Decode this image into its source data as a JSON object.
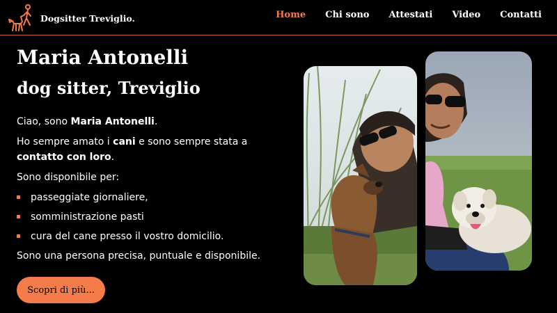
{
  "header": {
    "brand": "Dogsitter Treviglio.",
    "nav": [
      {
        "label": "Home",
        "active": true
      },
      {
        "label": "Chi sono",
        "active": false
      },
      {
        "label": "Attestati",
        "active": false
      },
      {
        "label": "Video",
        "active": false
      },
      {
        "label": "Contatti",
        "active": false
      }
    ]
  },
  "hero": {
    "title": "Maria Antonelli",
    "subtitle": "dog sitter, Treviglio"
  },
  "intro": {
    "greeting": "Ciao, sono ",
    "name": "Maria Antonelli",
    "greeting_end": ".",
    "love_1": "Ho sempre amato i ",
    "love_bold": "cani",
    "love_2": " e sono sempre stata a ",
    "contact_bold": "contatto con loro",
    "contact_end": ".",
    "available": "Sono disponibile per:",
    "services": [
      "passeggiate giornaliere,",
      "somministrazione pasti",
      "cura del cane presso il vostro domicilio."
    ],
    "closing": "Sono una persona precisa, puntuale e disponibile."
  },
  "cta": {
    "label": "Scopri di più..."
  },
  "colors": {
    "accent": "#f47c4b",
    "background": "#000000",
    "divider": "#c7643a"
  },
  "icons": {
    "logo": "walking-dog-logo-icon",
    "bullet": "square-bullet-icon"
  }
}
